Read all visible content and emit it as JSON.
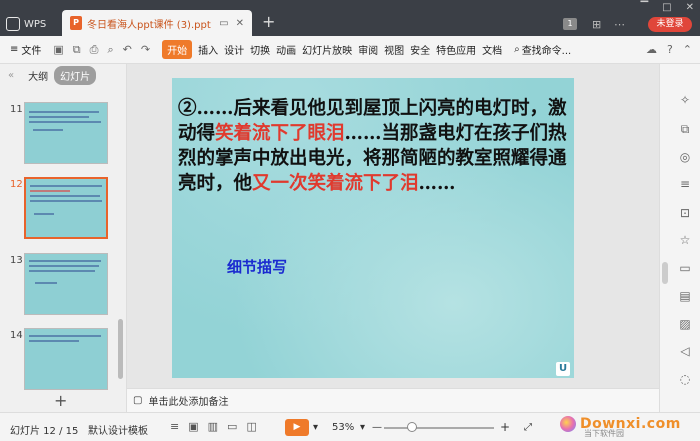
{
  "window": {
    "app_tab": "WPS",
    "doc_tab_title": "冬日看海人ppt课件 (3).ppt",
    "new_tab_icon": "plus-icon",
    "page_badge": "1",
    "login_label": "未登录"
  },
  "menubar": {
    "file": "文件",
    "start": "开始",
    "items": [
      "插入",
      "设计",
      "切换",
      "动画",
      "幻灯片放映",
      "审阅",
      "视图",
      "安全",
      "特色应用",
      "文档"
    ],
    "search": "查找命令..."
  },
  "left_panel": {
    "tab_outline": "大纲",
    "tab_slides": "幻灯片",
    "thumbs": [
      {
        "num": "11",
        "selected": false
      },
      {
        "num": "12",
        "selected": true
      },
      {
        "num": "13",
        "selected": false
      },
      {
        "num": "14",
        "selected": false
      }
    ],
    "add_label": "+"
  },
  "slide": {
    "p1": "②……后来看见他见到屋顶上闪亮的电灯时，激动得",
    "p1_hl": "笑着流下了眼泪",
    "p2": "……当那盏电灯在孩子们热烈的掌声中放出电光，将那简陋的教室照耀得通亮时，他",
    "p2_hl": "又一次笑着流下了泪",
    "p3": "……",
    "sub": "细节描写",
    "corner_mark": "U"
  },
  "notes": {
    "placeholder": "单击此处添加备注"
  },
  "status": {
    "slide_counter": "幻灯片 12 / 15",
    "template": "默认设计模板",
    "zoom": "53%",
    "zoom_minus": "—",
    "zoom_plus": "+"
  },
  "watermark": {
    "text": "Downxi.com",
    "sub": "当下软件园"
  },
  "colors": {
    "accent": "#ef7a2a",
    "highlight": "#e03a2e",
    "slide_bg": "#93d3d6",
    "subtitle": "#1a2ad0"
  }
}
